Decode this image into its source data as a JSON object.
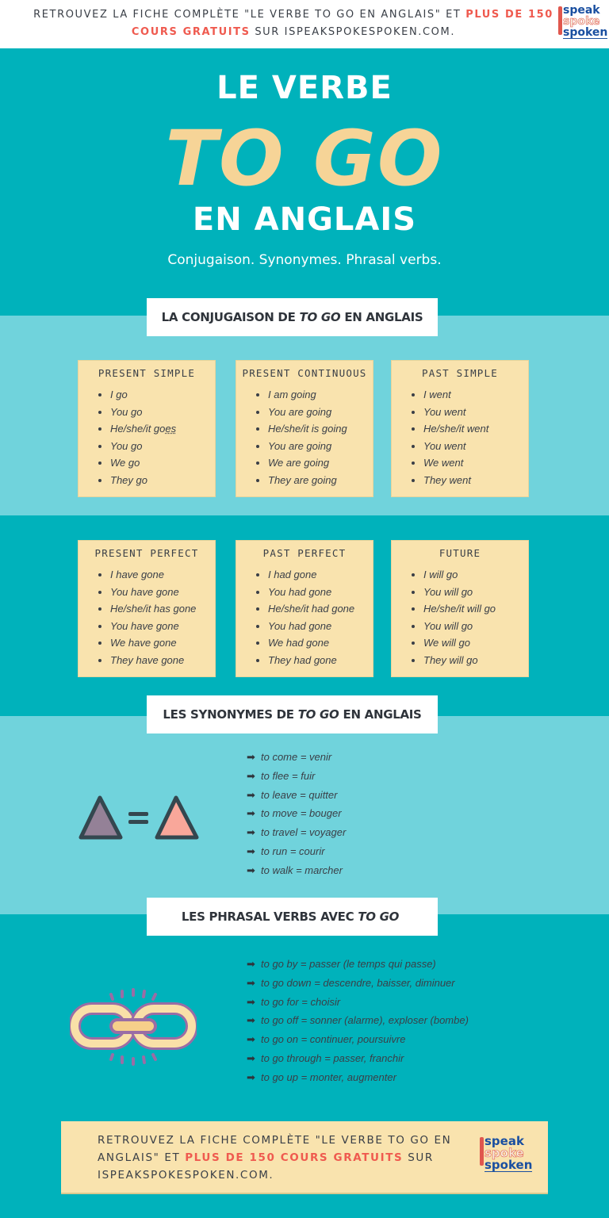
{
  "header": {
    "promo_part1": "RETROUVEZ LA FICHE COMPLÈTE \"LE VERBE TO GO EN ANGLAIS\" ET ",
    "promo_highlight": "PLUS DE 150 COURS GRATUITS",
    "promo_part2": " SUR ISPEAKSPOKESPOKEN.COM.",
    "logo": {
      "line1": "speak",
      "line2": "spoke",
      "line3": "spoken"
    }
  },
  "hero": {
    "line1": "LE VERBE",
    "line2": "TO GO",
    "line3": "EN ANGLAIS",
    "subtitle": "Conjugaison. Synonymes. Phrasal verbs."
  },
  "sections": {
    "conjugation": {
      "pre": "LA CONJUGAISON DE",
      "em": "TO GO",
      "post": "EN ANGLAIS"
    },
    "synonyms": {
      "pre": "LES SYNONYMES DE",
      "em": "TO GO",
      "post": "EN ANGLAIS"
    },
    "phrasal": {
      "pre": "LES PHRASAL VERBS AVEC",
      "em": "TO GO",
      "post": ""
    }
  },
  "tenses": [
    {
      "title": "PRESENT SIMPLE",
      "forms": [
        "I go",
        "You go",
        "He/she/it goes",
        "You go",
        "We go",
        "They go"
      ]
    },
    {
      "title": "PRESENT CONTINUOUS",
      "forms": [
        "I am going",
        "You are going",
        "He/she/it is going",
        "You are going",
        "We are going",
        "They are going"
      ]
    },
    {
      "title": "PAST SIMPLE",
      "forms": [
        "I went",
        "You went",
        "He/she/it went",
        "You went",
        "We went",
        "They went"
      ]
    },
    {
      "title": "PRESENT PERFECT",
      "forms": [
        "I have gone",
        "You have gone",
        "He/she/it has gone",
        "You have gone",
        "We have gone",
        "They have gone"
      ]
    },
    {
      "title": "PAST PERFECT",
      "forms": [
        "I had gone",
        "You had gone",
        "He/she/it had gone",
        "You had gone",
        "We had gone",
        "They had gone"
      ]
    },
    {
      "title": "FUTURE",
      "forms": [
        "I will go",
        "You will go",
        "He/she/it will go",
        "You will go",
        "We will go",
        "They will go"
      ]
    }
  ],
  "synonyms": {
    "icon": "equal-triangles-icon",
    "items": [
      "to come = venir",
      "to flee = fuir",
      "to leave = quitter",
      "to move = bouger",
      "to travel = voyager",
      "to run = courir",
      "to walk = marcher"
    ]
  },
  "phrasal_verbs": {
    "icon": "chain-link-icon",
    "items": [
      "to go by = passer (le temps qui passe)",
      "to go down = descendre, baisser, diminuer",
      "to go for = choisir",
      "to go off = sonner (alarme), exploser (bombe)",
      "to go on = continuer, poursuivre",
      "to go through = passer, franchir",
      "to go up = monter, augmenter"
    ]
  },
  "arrow_glyph": "➡",
  "footer": {
    "promo_part1": "RETROUVEZ LA FICHE COMPLÈTE \"LE VERBE TO GO EN ANGLAIS\" ET ",
    "promo_highlight": "PLUS DE 150 COURS GRATUITS",
    "promo_part2": " SUR ISPEAKSPOKESPOKEN.COM.",
    "logo": {
      "line1": "speak",
      "line2": "spoke",
      "line3": "spoken"
    }
  },
  "colors": {
    "teal": "#00b2bb",
    "light_teal": "#70d3dc",
    "card": "#f9e3ae",
    "accent_red": "#ef5a4f",
    "title_yellow": "#f6d497",
    "text_dark": "#3a3f47"
  }
}
